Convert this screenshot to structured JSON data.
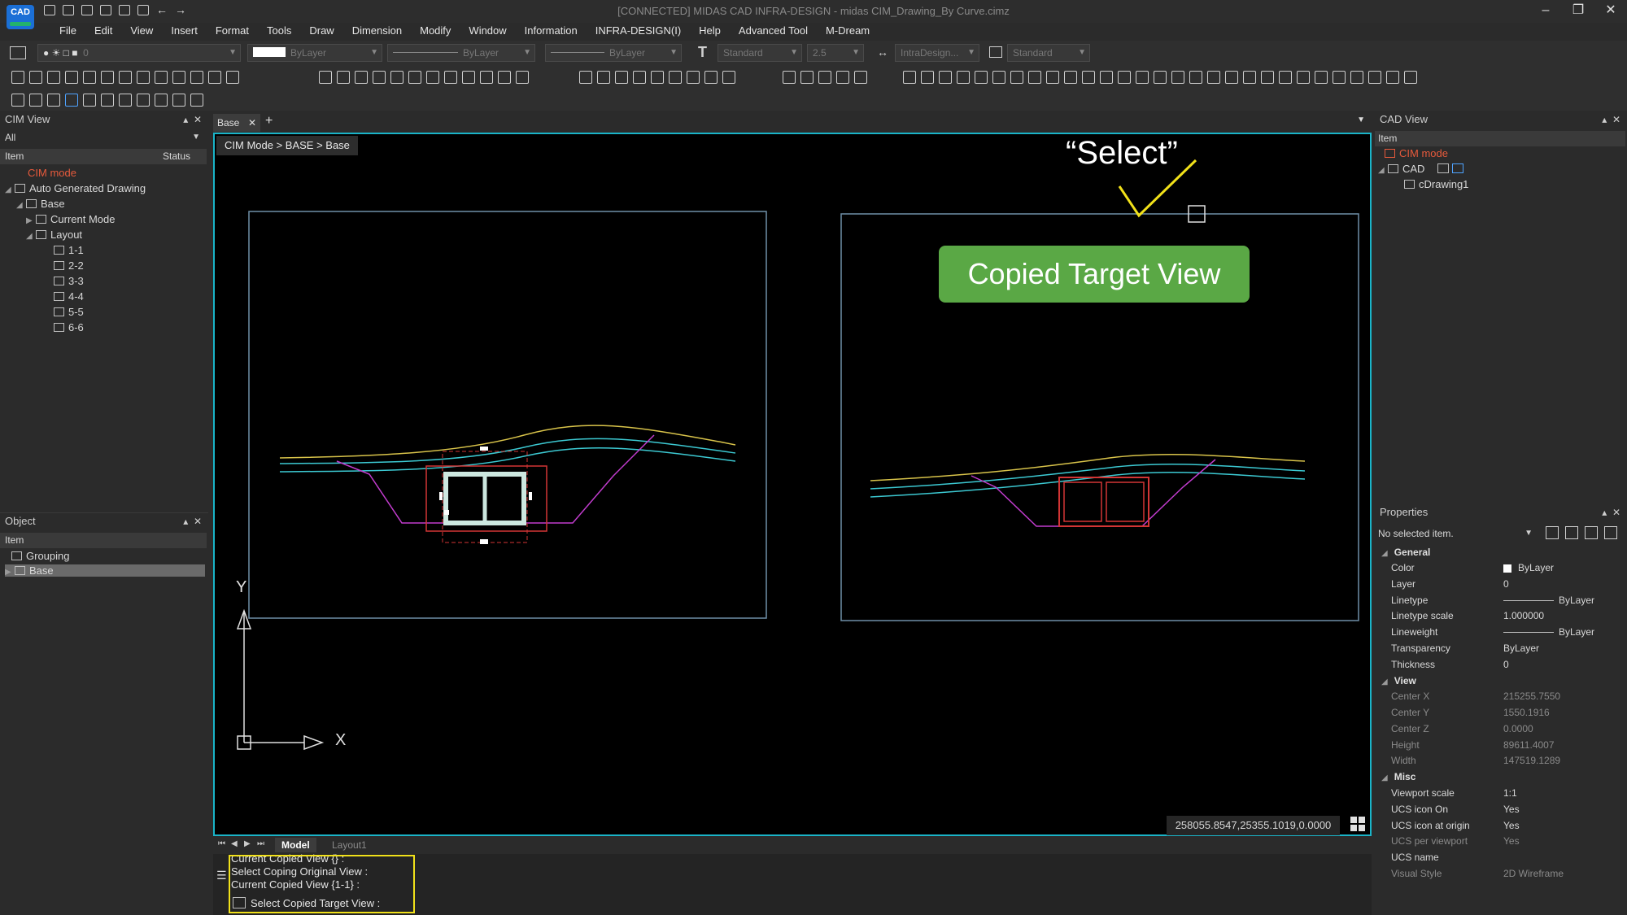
{
  "app": {
    "title": "[CONNECTED] MIDAS CAD INFRA-DESIGN - midas CIM_Drawing_By Curve.cimz",
    "logo_text": "CAD"
  },
  "menu": [
    "File",
    "Edit",
    "View",
    "Insert",
    "Format",
    "Tools",
    "Draw",
    "Dimension",
    "Modify",
    "Window",
    "Information",
    "INFRA-DESIGN(I)",
    "Help",
    "Advanced Tool",
    "M-Dream"
  ],
  "toolbar": {
    "layer_value": "0",
    "color_value": "ByLayer",
    "linetype_value": "ByLayer",
    "lineweight_value": "ByLayer",
    "text_style": "Standard",
    "text_height": "2.5",
    "dim_style": "IntraDesign...",
    "table_style": "Standard"
  },
  "cim_view": {
    "title": "CIM View",
    "filter": "All",
    "col_item": "Item",
    "col_status": "Status",
    "items": [
      {
        "label": "CIM mode"
      },
      {
        "label": "Auto Generated Drawing"
      },
      {
        "label": "Base"
      },
      {
        "label": "Current Mode"
      },
      {
        "label": "Layout"
      },
      {
        "label": "1-1"
      },
      {
        "label": "2-2"
      },
      {
        "label": "3-3"
      },
      {
        "label": "4-4"
      },
      {
        "label": "5-5"
      },
      {
        "label": "6-6"
      }
    ]
  },
  "object_panel": {
    "title": "Object",
    "col_item": "Item",
    "items": [
      {
        "label": "Grouping"
      },
      {
        "label": "Base"
      }
    ]
  },
  "document": {
    "tab": "Base",
    "breadcrumb": "CIM Mode > BASE > Base",
    "coordinates": "258055.8547,25355.1019,0.0000",
    "axis_x": "X",
    "axis_y": "Y",
    "layout_tabs": [
      "Model",
      "Layout1"
    ]
  },
  "annotations": {
    "select_label": "“Select”",
    "callout": "Copied Target View"
  },
  "command": {
    "lines": [
      "Current Copied View {} :",
      "Select Coping Original View :",
      "Current Copied View {1-1} :"
    ],
    "prompt": "Select Copied Target View :"
  },
  "cad_view": {
    "title": "CAD View",
    "col_item": "Item",
    "items": [
      {
        "label": "CIM mode"
      },
      {
        "label": "CAD"
      },
      {
        "label": "cDrawing1"
      }
    ]
  },
  "properties": {
    "title": "Properties",
    "selection": "No selected item.",
    "sections": {
      "general": "General",
      "view": "View",
      "misc": "Misc"
    },
    "general": [
      {
        "k": "Color",
        "v": "ByLayer"
      },
      {
        "k": "Layer",
        "v": "0"
      },
      {
        "k": "Linetype",
        "v": "ByLayer"
      },
      {
        "k": "Linetype scale",
        "v": "1.000000"
      },
      {
        "k": "Lineweight",
        "v": "ByLayer"
      },
      {
        "k": "Transparency",
        "v": "ByLayer"
      },
      {
        "k": "Thickness",
        "v": "0"
      }
    ],
    "view": [
      {
        "k": "Center X",
        "v": "215255.7550"
      },
      {
        "k": "Center Y",
        "v": "1550.1916"
      },
      {
        "k": "Center Z",
        "v": "0.0000"
      },
      {
        "k": "Height",
        "v": "89611.4007"
      },
      {
        "k": "Width",
        "v": "147519.1289"
      }
    ],
    "misc": [
      {
        "k": "Viewport scale",
        "v": "1:1"
      },
      {
        "k": "UCS icon On",
        "v": "Yes"
      },
      {
        "k": "UCS icon at origin",
        "v": "Yes"
      },
      {
        "k": "UCS per viewport",
        "v": "Yes"
      },
      {
        "k": "UCS name",
        "v": ""
      },
      {
        "k": "Visual Style",
        "v": "2D Wireframe"
      }
    ]
  },
  "colors": {
    "accent": "#1ab4c8",
    "callout": "#5aa845",
    "highlight": "#f1e11a",
    "cim_mode": "#e65a3c"
  }
}
